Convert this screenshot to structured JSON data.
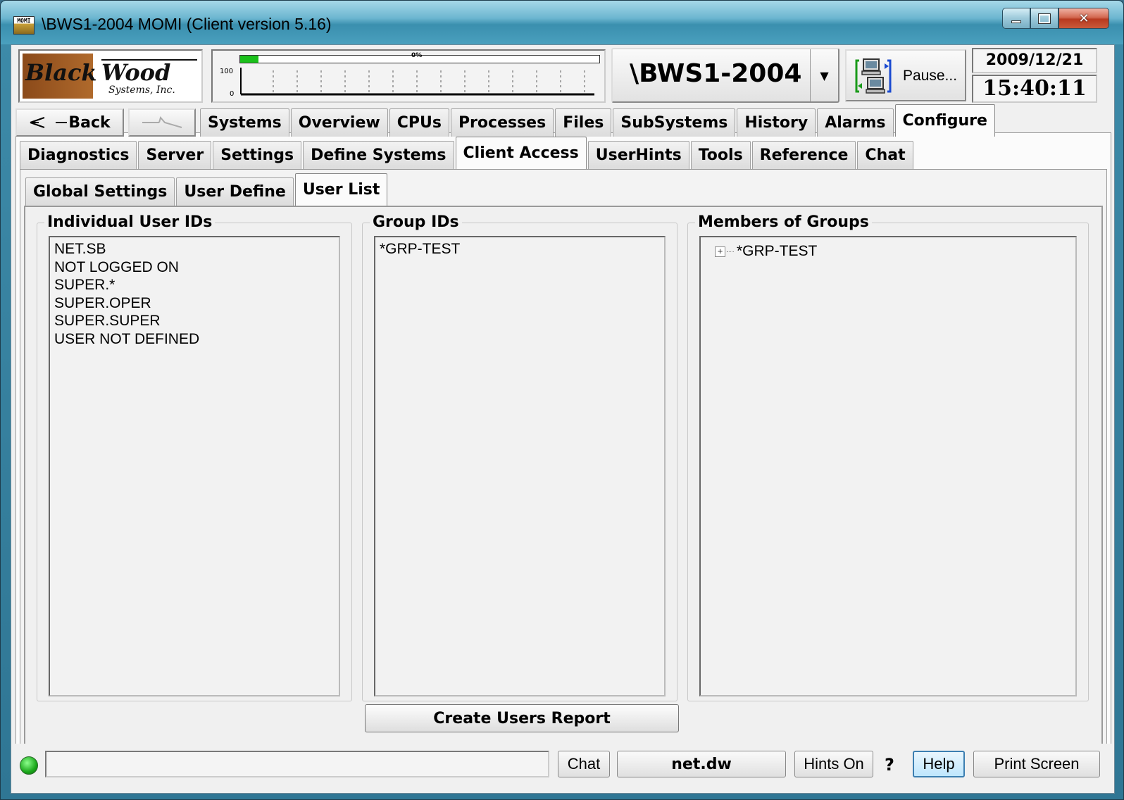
{
  "window": {
    "title": "\\BWS1-2004 MOMI (Client version 5.16)",
    "icon_label": "MOMI"
  },
  "header": {
    "logo": {
      "text1": "Black",
      "text2": "Wood",
      "text3": "Systems, Inc."
    },
    "cpu": {
      "percent_label": "0%",
      "busy_fraction": 0.05,
      "axis_max": "100",
      "axis_min": "0"
    },
    "system_name": "\\BWS1-2004",
    "pause_label": "Pause...",
    "date": "2009/12/21",
    "time": "15:40:11"
  },
  "nav": {
    "back_label": "Back",
    "main_tabs": [
      "Systems",
      "Overview",
      "CPUs",
      "Processes",
      "Files",
      "SubSystems",
      "History",
      "Alarms",
      "Configure"
    ],
    "main_active": "Configure",
    "sub_tabs": [
      "Diagnostics",
      "Server",
      "Settings",
      "Define Systems",
      "Client Access",
      "UserHints",
      "Tools",
      "Reference",
      "Chat"
    ],
    "sub_active": "Client Access",
    "sub2_tabs": [
      "Global Settings",
      "User Define",
      "User List"
    ],
    "sub2_active": "User List"
  },
  "content": {
    "individual_title": "Individual User IDs",
    "individual_users": [
      "NET.SB",
      "NOT LOGGED ON",
      "SUPER.*",
      "SUPER.OPER",
      "SUPER.SUPER",
      "USER NOT DEFINED"
    ],
    "group_title": "Group IDs",
    "groups": [
      "*GRP-TEST"
    ],
    "members_title": "Members of Groups",
    "member_tree": [
      "*GRP-TEST"
    ],
    "report_button": "Create Users Report"
  },
  "statusbar": {
    "status_text": "",
    "chat_label": "Chat",
    "user_label": "net.dw",
    "hints_label": "Hints On",
    "question": "?",
    "help_label": "Help",
    "print_label": "Print Screen"
  },
  "colors": {
    "titlebar": "#4aa0be",
    "client_bg": "#f0f0f0",
    "cpu_fill": "#1ac01a",
    "status_led": "#1ca81c",
    "help_border": "#3c7fb1"
  }
}
